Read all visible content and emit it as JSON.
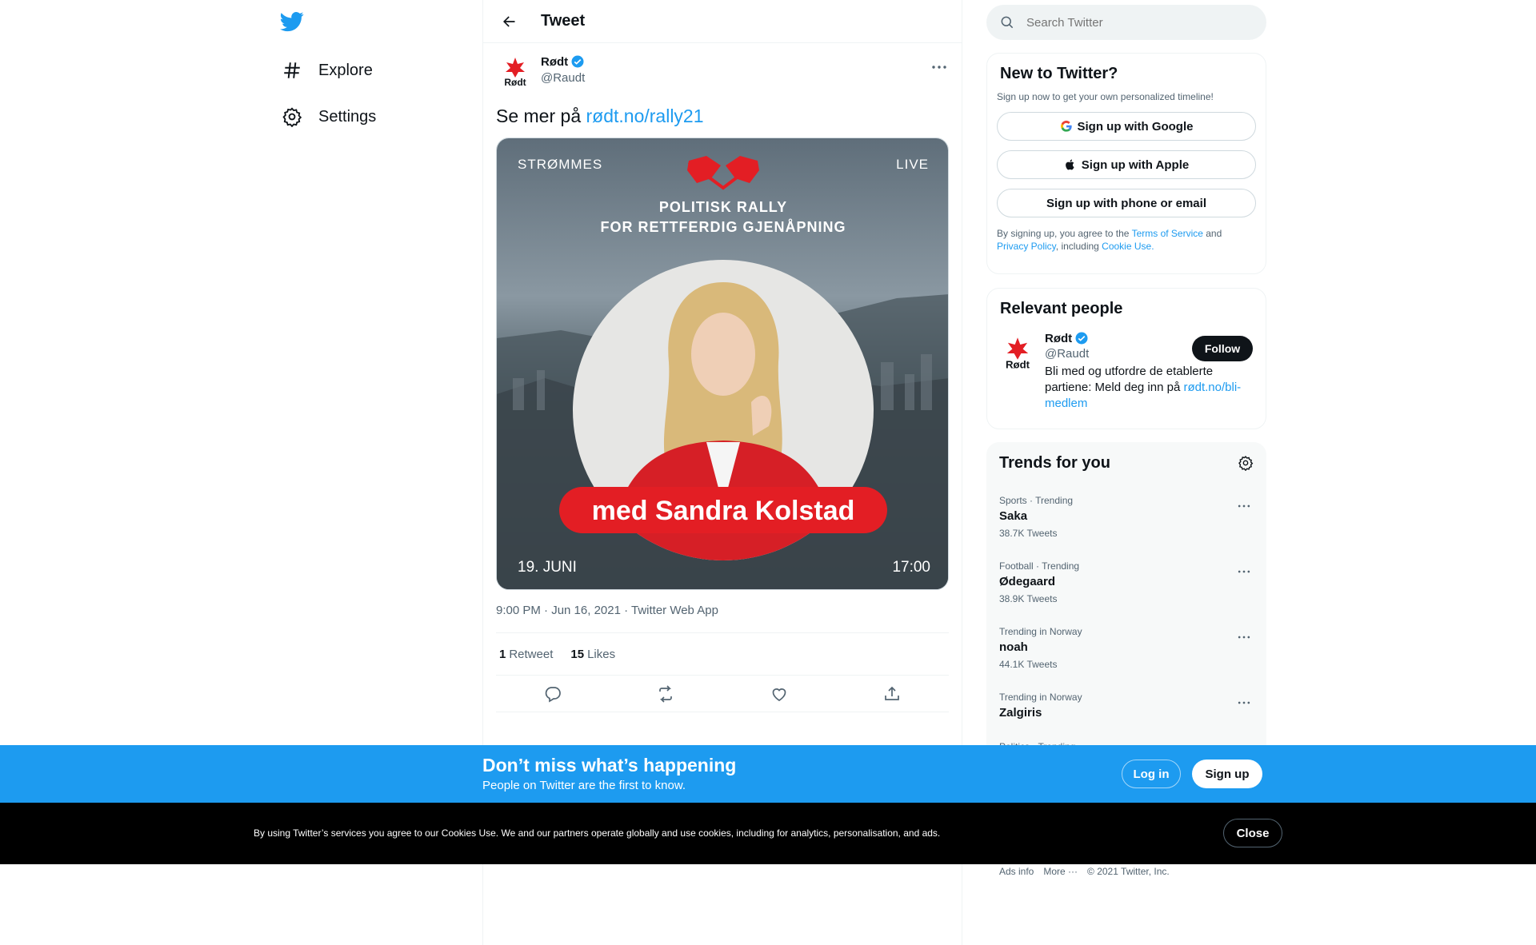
{
  "nav": {
    "items": [
      {
        "label": "Explore",
        "icon": "hashtag-icon"
      },
      {
        "label": "Settings",
        "icon": "gear-icon"
      }
    ]
  },
  "header": {
    "title": "Tweet"
  },
  "tweet": {
    "author_name": "Rødt",
    "author_handle": "@Raudt",
    "avatar_text": "Rødt",
    "text_prefix": "Se mer på ",
    "link": "rødt.no/rally21",
    "meta": "9:00 PM · Jun 16, 2021 · Twitter Web App",
    "retweets": "1",
    "retweets_label": "Retweet",
    "likes": "15",
    "likes_label": "Likes",
    "media": {
      "top_left": "STRØMMES",
      "top_right": "LIVE",
      "headline_1": "POLITISK RALLY",
      "headline_2": "FOR RETTFERDIG GJENÅPNING",
      "banner": "med Sandra Kolstad",
      "date": "19. JUNI",
      "time": "17:00"
    }
  },
  "search": {
    "placeholder": "Search Twitter"
  },
  "new_to_twitter": {
    "title": "New to Twitter?",
    "subtitle": "Sign up now to get your own personalized timeline!",
    "google": "Sign up with Google",
    "apple": "Sign up with Apple",
    "phone": "Sign up with phone or email",
    "legal_1": "By signing up, you agree to the ",
    "terms": "Terms of Service",
    "legal_2": " and ",
    "privacy": "Privacy Policy",
    "legal_3": ", including ",
    "cookie": "Cookie Use."
  },
  "relevant": {
    "title": "Relevant people",
    "name": "Rødt",
    "handle": "@Raudt",
    "bio": "Bli med og utfordre de etablerte partiene: Meld deg inn på ",
    "bio_link": "rødt.no/bli-medlem",
    "follow": "Follow"
  },
  "trends": {
    "title": "Trends for you",
    "items": [
      {
        "category": "Sports · Trending",
        "name": "Saka",
        "count": "38.7K Tweets"
      },
      {
        "category": "Football · Trending",
        "name": "Ødegaard",
        "count": "38.9K Tweets"
      },
      {
        "category": "Trending in Norway",
        "name": "noah",
        "count": "44.1K Tweets"
      },
      {
        "category": "Trending in Norway",
        "name": "Zalgiris",
        "count": ""
      },
      {
        "category": "Politics · Trending",
        "name": "",
        "count": ""
      }
    ]
  },
  "footer": {
    "ads": "Ads info",
    "more": "More ···",
    "copyright": "© 2021 Twitter, Inc."
  },
  "banner": {
    "title": "Don’t miss what’s happening",
    "subtitle": "People on Twitter are the first to know.",
    "login": "Log in",
    "signup": "Sign up"
  },
  "cookie_bar": {
    "text": "By using Twitter’s services you agree to our Cookies Use. We and our partners operate globally and use cookies, including for analytics, personalisation, and ads.",
    "close": "Close"
  },
  "colors": {
    "accent": "#1d9bf0",
    "text": "#0f1419",
    "muted": "#536471",
    "brand_red": "#e31e24"
  }
}
